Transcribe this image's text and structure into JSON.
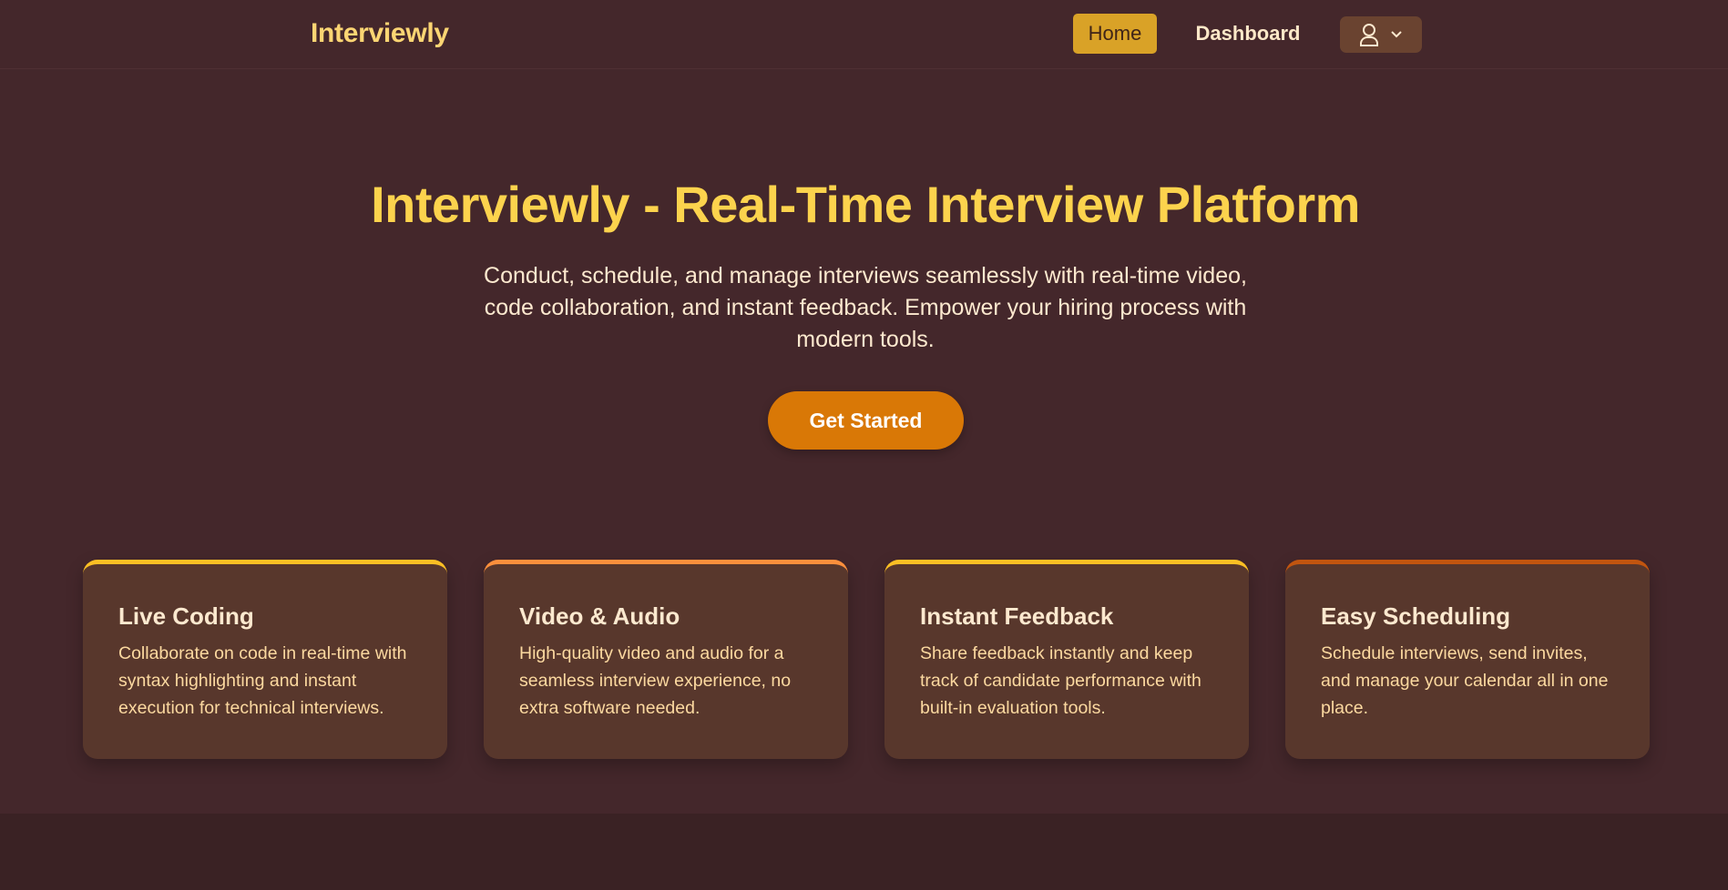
{
  "nav": {
    "brand": "Interviewly",
    "home": "Home",
    "dashboard": "Dashboard",
    "user_icon": "user-icon",
    "chevron_icon": "chevron-down-icon"
  },
  "hero": {
    "title": "Interviewly - Real-Time Interview Platform",
    "subtitle": "Conduct, schedule, and manage interviews seamlessly with real-time video, code collaboration, and instant feedback. Empower your hiring process with modern tools.",
    "cta": "Get Started"
  },
  "features": [
    {
      "title": "Live Coding",
      "description": "Collaborate on code in real-time with syntax highlighting and instant execution for technical interviews.",
      "accent": "#fbbf24"
    },
    {
      "title": "Video & Audio",
      "description": "High-quality video and audio for a seamless interview experience, no extra software needed.",
      "accent": "#fb8f3c"
    },
    {
      "title": "Instant Feedback",
      "description": "Share feedback instantly and keep track of candidate performance with built-in evaluation tools.",
      "accent": "#fbbf24"
    },
    {
      "title": "Easy Scheduling",
      "description": "Schedule interviews, send invites, and manage your calendar all in one place.",
      "accent": "#c2550f"
    }
  ],
  "colors": {
    "background": "#44272b",
    "brand": "#fcd573",
    "title": "#fcd34d",
    "cta": "#d97806",
    "card": "#58372c"
  }
}
